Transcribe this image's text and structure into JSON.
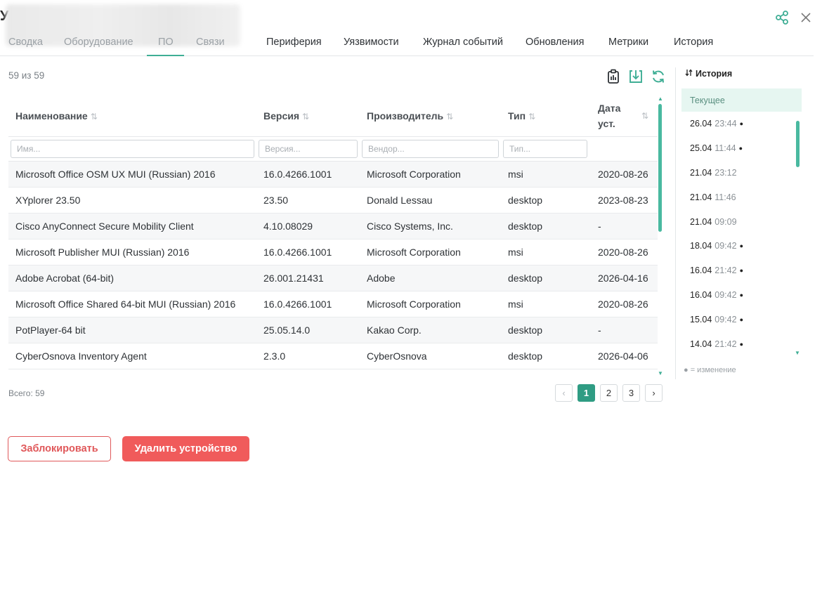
{
  "header": {
    "title_letter": "У"
  },
  "tabs": [
    {
      "label": "Сводка"
    },
    {
      "label": "Оборудование"
    },
    {
      "label": "ПО"
    },
    {
      "label": "Связи"
    },
    {
      "label": "Периферия"
    },
    {
      "label": "Уязвимости"
    },
    {
      "label": "Журнал событий"
    },
    {
      "label": "Обновления"
    },
    {
      "label": "Метрики"
    },
    {
      "label": "История"
    }
  ],
  "count_text": "59 из 59",
  "table": {
    "columns": [
      "Наименование",
      "Версия",
      "Производитель",
      "Тип",
      "Дата уст."
    ],
    "filters": [
      "Имя...",
      "Версия...",
      "Вендор...",
      "Тип..."
    ],
    "rows": [
      [
        "Microsoft Office OSM UX MUI (Russian) 2016",
        "16.0.4266.1001",
        "Microsoft Corporation",
        "msi",
        "2020-08-26"
      ],
      [
        "XYplorer 23.50",
        "23.50",
        "Donald Lessau",
        "desktop",
        "2023-08-23"
      ],
      [
        "Cisco AnyConnect Secure Mobility Client",
        "4.10.08029",
        "Cisco Systems, Inc.",
        "desktop",
        "-"
      ],
      [
        "Microsoft Publisher MUI (Russian) 2016",
        "16.0.4266.1001",
        "Microsoft Corporation",
        "msi",
        "2020-08-26"
      ],
      [
        "Adobe Acrobat (64-bit)",
        "26.001.21431",
        "Adobe",
        "desktop",
        "2026-04-16"
      ],
      [
        "Microsoft Office Shared 64-bit MUI (Russian) 2016",
        "16.0.4266.1001",
        "Microsoft Corporation",
        "msi",
        "2020-08-26"
      ],
      [
        "PotPlayer-64 bit",
        "25.05.14.0",
        "Kakao Corp.",
        "desktop",
        "-"
      ],
      [
        "CyberOsnova Inventory Agent",
        "2.3.0",
        "CyberOsnova",
        "desktop",
        "2026-04-06"
      ]
    ]
  },
  "footer": {
    "total": "Всего: 59"
  },
  "pagination": {
    "prev": "‹",
    "pages": [
      "1",
      "2",
      "3"
    ],
    "current": "1",
    "next": "›"
  },
  "actions": {
    "block": "Заблокировать",
    "delete": "Удалить устройство"
  },
  "history": {
    "title": "История",
    "items": [
      {
        "date": "Текущее",
        "time": "",
        "changed": false,
        "current": true
      },
      {
        "date": "26.04",
        "time": "23:44",
        "changed": true
      },
      {
        "date": "25.04",
        "time": "11:44",
        "changed": true
      },
      {
        "date": "21.04",
        "time": "23:12",
        "changed": false
      },
      {
        "date": "21.04",
        "time": "11:46",
        "changed": false
      },
      {
        "date": "21.04",
        "time": "09:09",
        "changed": false
      },
      {
        "date": "18.04",
        "time": "09:42",
        "changed": true
      },
      {
        "date": "16.04",
        "time": "21:42",
        "changed": true
      },
      {
        "date": "16.04",
        "time": "09:42",
        "changed": true
      },
      {
        "date": "15.04",
        "time": "09:42",
        "changed": true
      },
      {
        "date": "14.04",
        "time": "21:42",
        "changed": true
      }
    ],
    "legend": "● = изменение"
  },
  "colors": {
    "accent": "#3fae95",
    "danger": "#f05b5b"
  },
  "icons": [
    "share-icon",
    "close-icon",
    "clipboard-icon",
    "download-icon",
    "refresh-icon",
    "history-swap-icon"
  ]
}
